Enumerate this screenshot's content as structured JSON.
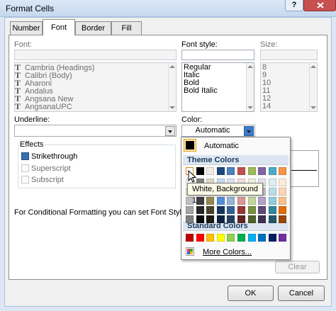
{
  "window": {
    "title": "Format Cells",
    "help_label": "?"
  },
  "tabs": [
    {
      "label": "Number"
    },
    {
      "label": "Font"
    },
    {
      "label": "Border"
    },
    {
      "label": "Fill"
    }
  ],
  "font": {
    "label": "Font:",
    "value": "",
    "items": [
      "Cambria (Headings)",
      "Calibri (Body)",
      "Aharoni",
      "Andalus",
      "Angsana New",
      "AngsanaUPC"
    ]
  },
  "font_style": {
    "label": "Font style:",
    "value": "",
    "items": [
      "Regular",
      "Italic",
      "Bold",
      "Bold Italic"
    ]
  },
  "size": {
    "label": "Size:",
    "value": "",
    "items": [
      "8",
      "9",
      "10",
      "11",
      "12",
      "14"
    ]
  },
  "underline": {
    "label": "Underline:",
    "value": ""
  },
  "color": {
    "label": "Color:",
    "value": "Automatic"
  },
  "effects": {
    "title": "Effects",
    "strikethrough": {
      "label": "Strikethrough",
      "checked": true
    },
    "superscript": {
      "label": "Superscript",
      "checked": false
    },
    "subscript": {
      "label": "Subscript",
      "checked": false
    }
  },
  "info_text": "For Conditional Formatting you can set Font Style, Unde",
  "clear_label": "Clear",
  "ok_label": "OK",
  "cancel_label": "Cancel",
  "color_popup": {
    "automatic_label": "Automatic",
    "theme_heading": "Theme Colors",
    "standard_heading": "Standard Colors",
    "more_colors_label": "More Colors...",
    "theme_colors": [
      [
        "#FFFFFF",
        "#000000",
        "#EEECE1",
        "#1F497D",
        "#4F81BD",
        "#C0504D",
        "#9BBB59",
        "#8064A2",
        "#4BACC6",
        "#F79646"
      ],
      [
        "#F2F2F2",
        "#7F7F7F",
        "#DDD9C3",
        "#C6D9F0",
        "#DBE5F1",
        "#F2DCDB",
        "#EBF1DD",
        "#E5E0EC",
        "#DBEEF3",
        "#FDEADA"
      ],
      [
        "#D8D8D8",
        "#595959",
        "#C4BD97",
        "#8DB3E2",
        "#B8CCE4",
        "#E5B9B7",
        "#D7E3BC",
        "#CCC1D9",
        "#B7DDE8",
        "#FBD5B5"
      ],
      [
        "#BFBFBF",
        "#3F3F3F",
        "#938953",
        "#548DD4",
        "#95B3D7",
        "#D99694",
        "#C3D69B",
        "#B2A2C7",
        "#92CDDC",
        "#FAC08F"
      ],
      [
        "#A5A5A5",
        "#262626",
        "#494429",
        "#17365D",
        "#366092",
        "#953734",
        "#76923C",
        "#5F497A",
        "#31859B",
        "#E36C09"
      ],
      [
        "#7F7F7F",
        "#0C0C0C",
        "#1D1B10",
        "#0F243E",
        "#244061",
        "#632423",
        "#4F6128",
        "#3F3151",
        "#205867",
        "#974806"
      ]
    ],
    "standard_colors": [
      "#C00000",
      "#FF0000",
      "#FFC000",
      "#FFFF00",
      "#92D050",
      "#00B050",
      "#00B0F0",
      "#0070C0",
      "#002060",
      "#7030A0"
    ]
  },
  "tooltip": "White, Background 1"
}
